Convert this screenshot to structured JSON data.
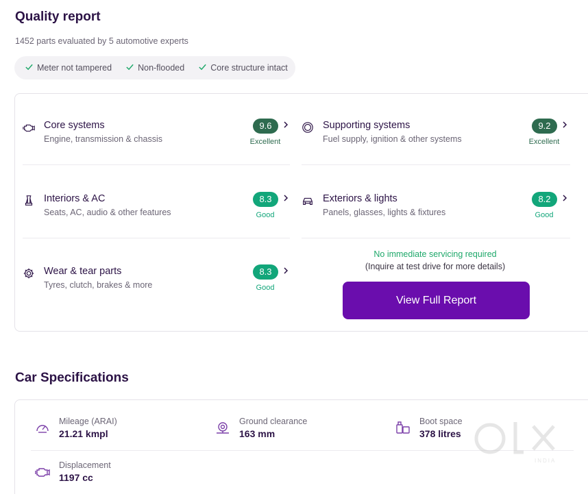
{
  "quality": {
    "title": "Quality report",
    "subtitle": "1452 parts evaluated by 5 automotive experts",
    "chips": [
      {
        "label": "Meter not tampered",
        "icon": "check-icon"
      },
      {
        "label": "Non-flooded",
        "icon": "check-icon"
      },
      {
        "label": "Core structure intact",
        "icon": "check-icon"
      }
    ],
    "systems": [
      {
        "title": "Core systems",
        "desc": "Engine, transmission & chassis",
        "score": "9.6",
        "label": "Excellent",
        "icon": "engine-icon"
      },
      {
        "title": "Supporting systems",
        "desc": "Fuel supply, ignition & other systems",
        "score": "9.2",
        "label": "Excellent",
        "icon": "steering-wheel-icon"
      },
      {
        "title": "Interiors & AC",
        "desc": "Seats, AC, audio & other features",
        "score": "8.3",
        "label": "Good",
        "icon": "seat-icon"
      },
      {
        "title": "Exteriors & lights",
        "desc": "Panels, glasses, lights & fixtures",
        "score": "8.2",
        "label": "Good",
        "icon": "car-front-icon"
      },
      {
        "title": "Wear & tear parts",
        "desc": "Tyres, clutch, brakes & more",
        "score": "8.3",
        "label": "Good",
        "icon": "gear-icon"
      }
    ],
    "note": "No immediate servicing required",
    "note_sub": "(Inquire at test drive for more details)",
    "button": "View Full Report"
  },
  "specs": {
    "title": "Car Specifications",
    "items": [
      {
        "label": "Mileage (ARAI)",
        "value": "21.21 kmpl",
        "icon": "speedometer-icon"
      },
      {
        "label": "Ground clearance",
        "value": "163 mm",
        "icon": "ground-clearance-icon"
      },
      {
        "label": "Boot space",
        "value": "378 litres",
        "icon": "luggage-icon"
      },
      {
        "label": "Displacement",
        "value": "1197 cc",
        "icon": "engine-icon"
      }
    ]
  },
  "watermark": {
    "brand": "OLX",
    "region": "INDIA"
  },
  "colors": {
    "excellent_badge": "#2e6b4f",
    "good_badge": "#12a67a",
    "good_text": "#12a67a",
    "excellent_text": "#2e6b4f",
    "accent_purple": "#6a0dad",
    "icon_purple": "#7b3fa8"
  }
}
